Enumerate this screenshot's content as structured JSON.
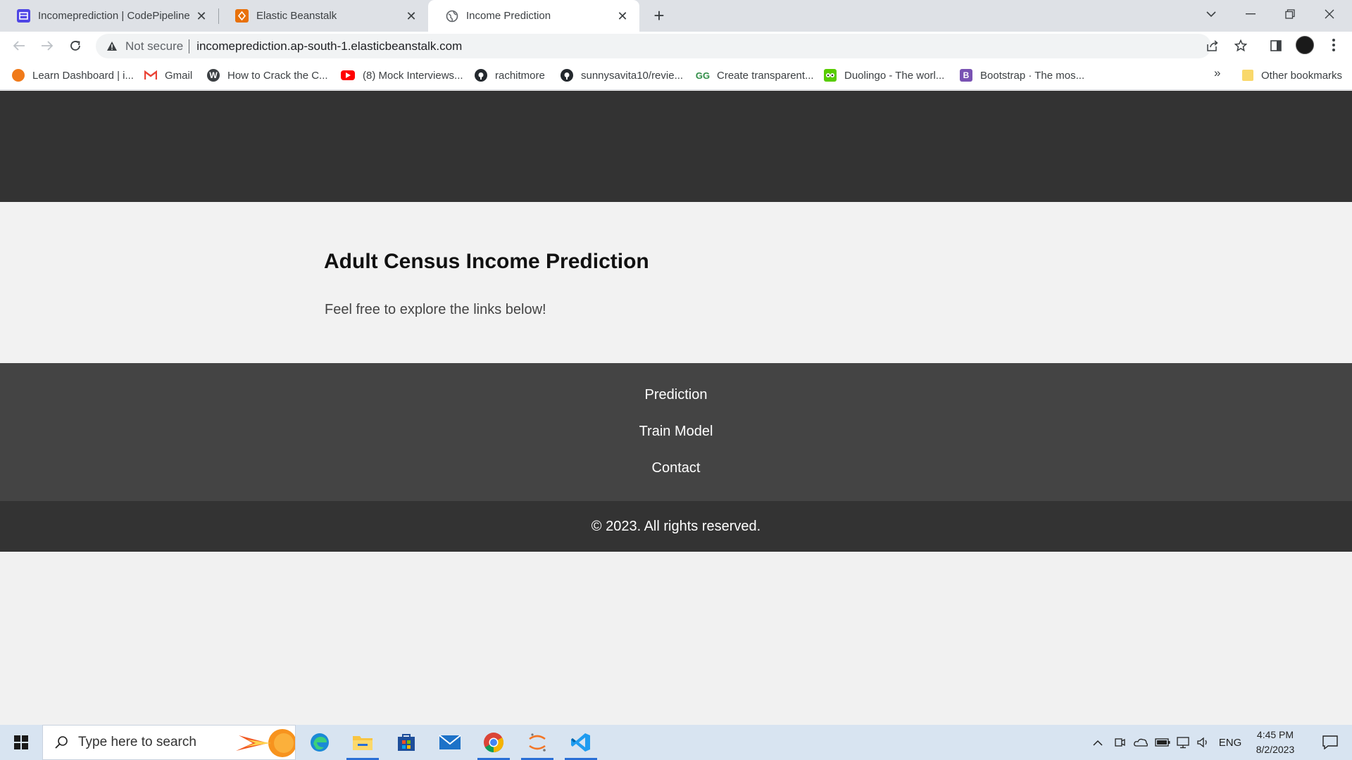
{
  "browser": {
    "tabs": [
      {
        "title": "Incomeprediction | CodePipeline",
        "icon": "codepipeline-icon",
        "color": "#4f46e5",
        "active": false
      },
      {
        "title": "Elastic Beanstalk",
        "icon": "elastic-beanstalk-icon",
        "color": "#e8710a",
        "active": false
      },
      {
        "title": "Income Prediction",
        "icon": "globe-icon",
        "color": "#5f6368",
        "active": true
      }
    ],
    "new_tab_label": "+",
    "address": {
      "security_label": "Not secure",
      "url": "incomeprediction.ap-south-1.elasticbeanstalk.com"
    },
    "bookmarks": [
      {
        "label": "Learn Dashboard | i...",
        "icon": "learn-icon",
        "color": "#f07a1a"
      },
      {
        "label": "Gmail",
        "icon": "gmail-icon",
        "color": "#ea4335"
      },
      {
        "label": "How to Crack the C...",
        "icon": "wordpress-icon",
        "color": "#3c4043"
      },
      {
        "label": "(8) Mock Interviews...",
        "icon": "youtube-icon",
        "color": "#ff0000"
      },
      {
        "label": "rachitmore",
        "icon": "github-icon",
        "color": "#24292e"
      },
      {
        "label": "sunnysavita10/revie...",
        "icon": "github-icon",
        "color": "#24292e"
      },
      {
        "label": "Create transparent...",
        "icon": "geeksforgeeks-icon",
        "color": "#2f8d46"
      },
      {
        "label": "Duolingo - The worl...",
        "icon": "duolingo-icon",
        "color": "#58cc02"
      },
      {
        "label": "Bootstrap · The mos...",
        "icon": "bootstrap-icon",
        "color": "#7952b3"
      }
    ],
    "bookmarks_overflow": "»",
    "other_bookmarks_label": "Other bookmarks"
  },
  "page": {
    "title": "Adult Census Income Prediction",
    "subtitle": "Feel free to explore the links below!",
    "links": [
      "Prediction",
      "Train Model",
      "Contact"
    ],
    "footer_text": "© 2023. All rights reserved."
  },
  "taskbar": {
    "search_placeholder": "Type here to search",
    "apps": [
      "edge-icon",
      "file-explorer-icon",
      "microsoft-store-icon",
      "mail-icon",
      "chrome-icon",
      "jupyter-icon",
      "vscode-icon"
    ],
    "language": "ENG",
    "time": "4:45 PM",
    "date": "8/2/2023"
  },
  "colors": {
    "header_bg": "#333333",
    "links_band_bg": "#444444",
    "page_bg": "#f2f2f2",
    "taskbar_bg": "#d8e4f1"
  }
}
